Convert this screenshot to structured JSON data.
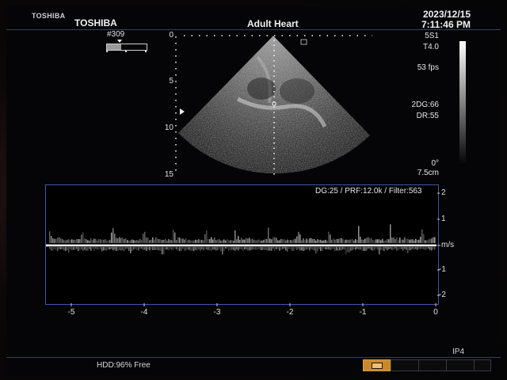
{
  "header": {
    "brand_small": "TOSHIBA",
    "brand": "TOSHIBA",
    "preset": "Adult Heart",
    "date": "2023/12/15",
    "time": "7:11:46 PM"
  },
  "cine": {
    "frame_label": "#309",
    "progress": 0.35
  },
  "bmode": {
    "depth_marks": [
      "0",
      "5",
      "10",
      "15"
    ],
    "probe": "5S1",
    "tissue_mode": "T4.0",
    "frame_rate": "53 fps",
    "dynamic_gain": "2DG:66",
    "dynamic_range": "DR:55",
    "angle": "0°",
    "depth_value": "7.5cm"
  },
  "doppler": {
    "info": "DG:25 /   PRF:12.0k / Filter:563",
    "unit": "m/s",
    "velocity_ticks": [
      "2",
      "1",
      "-1",
      "-2"
    ],
    "time_ticks": [
      "-5",
      "-4",
      "-3",
      "-2",
      "-1",
      "0"
    ]
  },
  "footer": {
    "hdd_status": "HDD:96% Free",
    "ip_label": "IP4"
  },
  "colors": {
    "frame_border": "#3f57a8",
    "active_key": "#c9892a"
  }
}
